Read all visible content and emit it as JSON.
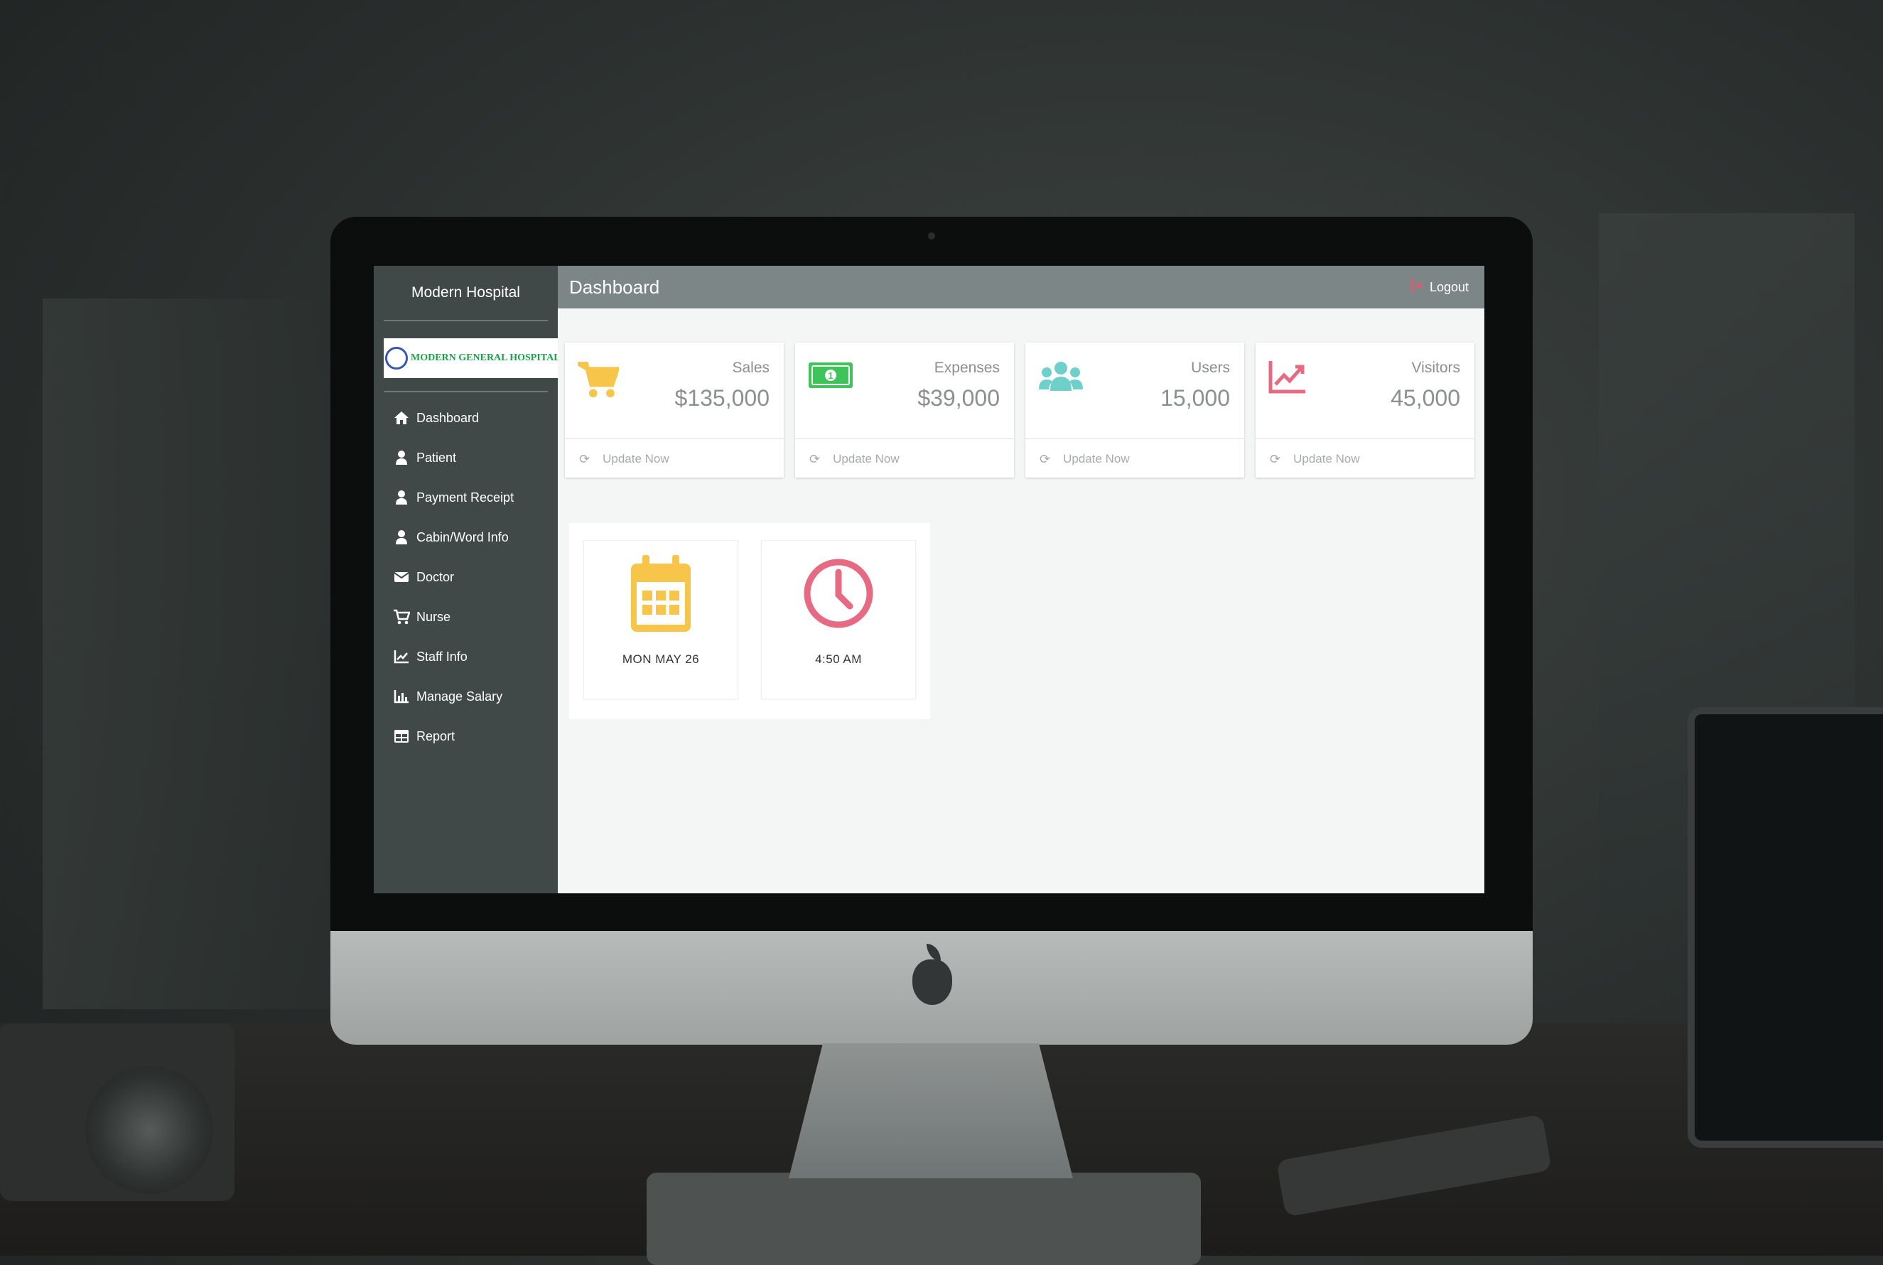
{
  "sidebar": {
    "title": "Modern Hospital",
    "logo_text": "MODERN GENERAL HOSPITAL AND DIAGNOSTIC CENTER",
    "items": [
      {
        "label": "Dashboard",
        "icon": "home-icon"
      },
      {
        "label": "Patient",
        "icon": "user-icon"
      },
      {
        "label": "Payment Receipt",
        "icon": "user-icon"
      },
      {
        "label": "Cabin/Word Info",
        "icon": "user-icon"
      },
      {
        "label": "Doctor",
        "icon": "envelope-icon"
      },
      {
        "label": "Nurse",
        "icon": "cart-icon"
      },
      {
        "label": "Staff Info",
        "icon": "line-chart-icon"
      },
      {
        "label": "Manage Salary",
        "icon": "bar-chart-icon"
      },
      {
        "label": "Report",
        "icon": "table-icon"
      }
    ]
  },
  "header": {
    "title": "Dashboard",
    "logout_label": "Logout"
  },
  "cards": [
    {
      "label": "Sales",
      "value": "$135,000",
      "footer": "Update Now",
      "icon": "cart-icon",
      "color": "#f6c549"
    },
    {
      "label": "Expenses",
      "value": "$39,000",
      "footer": "Update Now",
      "icon": "money-icon",
      "color": "#3fc45a"
    },
    {
      "label": "Users",
      "value": "15,000",
      "footer": "Update Now",
      "icon": "users-icon",
      "color": "#6fcfcb"
    },
    {
      "label": "Visitors",
      "value": "45,000",
      "footer": "Update Now",
      "icon": "chart-icon",
      "color": "#e66a82"
    }
  ],
  "widgets": {
    "date": {
      "label": "MON MAY 26",
      "icon": "calendar-icon",
      "color": "#f6c549"
    },
    "time": {
      "label": "4:50 AM",
      "icon": "clock-icon",
      "color": "#e66a82"
    }
  },
  "colors": {
    "sidebar": "#414948",
    "topbar": "#7c8686",
    "logout_icon": "#e15a6e"
  }
}
